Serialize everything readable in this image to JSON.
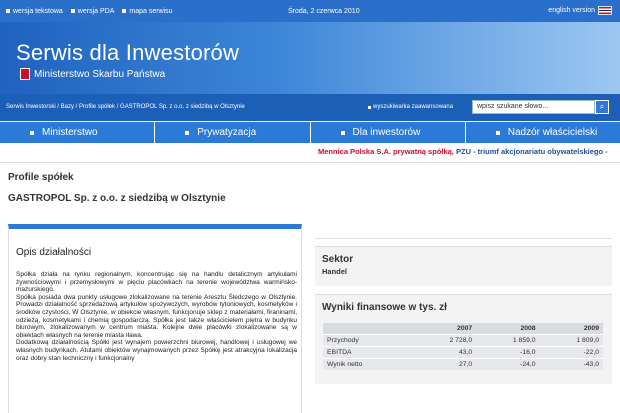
{
  "topbar": {
    "links": [
      "wersja tekstowa",
      "wersja PDA",
      "mapa serwisu"
    ],
    "date": "Środa, 2 czerwca 2010",
    "lang": "english version"
  },
  "header": {
    "site_title": "Serwis dla Inwestorów",
    "ministry": "Ministerstwo Skarbu Państwa"
  },
  "breadcrumb": "Serwis Inwestorski / Bazy / Profile spółek / GASTROPOL Sp. z o.o. z siedzibą w Olsztynie",
  "search": {
    "advanced": "wyszukiwarka zaawansowana",
    "placeholder": "wpisz szukane słowo..."
  },
  "nav": [
    "Ministerstwo",
    "Prywatyzacja",
    "Dla inwestorów",
    "Nadzór właścicielski"
  ],
  "ticker": {
    "red": "Mennica Polska S.A. prywatną spółką,",
    "blue": "PZU - triumf akcjonariatu obywatelskiego -"
  },
  "page": {
    "section": "Profile spółek",
    "company": "GASTROPOL Sp. z o.o. z siedzibą w Olsztynie"
  },
  "description": {
    "title": "Opis działalności",
    "paragraphs": [
      "Spółka działa na rynku regionalnym, koncentrując się na handlu detalicznym artykułami żywnościowymi i przemysłowymi w pięciu placówkach na terenie województwa warmińsko-mazurskiego.",
      "Spółka posiada dwa punkty usługowe zlokalizowane na terenie Aresztu Śledczego w Olsztynie. Prowadzi działalność sprzedażową artykułów spożywczych, wyrobów tytoniowych, kosmetyków i środków czystości. W Olsztynie, w obiekcie własnym, funkcjonuje sklep z materiałami, firaninami, odzieżą, kosmetykami i chemią gospodarczą. Spółka jest także właścicielem piętra w budynku biurowym, zlokalizowanym w centrum miasta. Kolejne dwie placówki zlokalizowane są w obiektach własnych na terenie miasta Iława.",
      "Dodatkową działalnością Spółki jest wynajem powierzchni biurowej, handlowej i usługowej we własnych budynkach. Atutami obiektów wynajmowanych przez Spółkę jest atrakcyjna lokalizacja oraz dobry stan techniczny i funkcjonalny"
    ]
  },
  "sector": {
    "title": "Sektor",
    "value": "Handel"
  },
  "financials": {
    "title": "Wyniki finansowe w tys. zł",
    "years": [
      "2007",
      "2008",
      "2009"
    ],
    "rows": [
      {
        "label": "Przychody",
        "values": [
          "2 728,0",
          "1 859,0",
          "1 809,0"
        ]
      },
      {
        "label": "EBITDA",
        "values": [
          "43,0",
          "-16,0",
          "-22,0"
        ]
      },
      {
        "label": "Wynik netto",
        "values": [
          "27,0",
          "-24,0",
          "-43,0"
        ]
      }
    ]
  }
}
